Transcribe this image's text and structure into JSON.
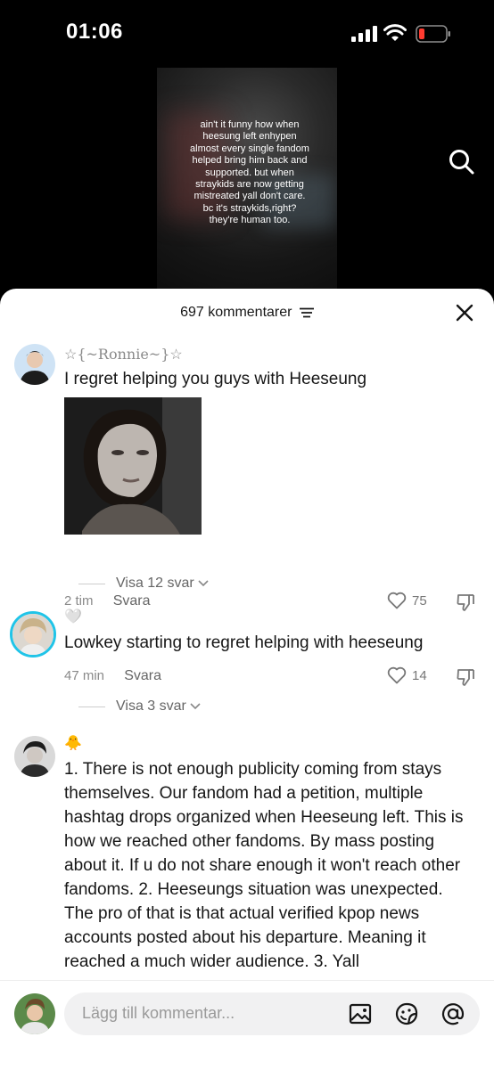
{
  "status_bar": {
    "time": "01:06"
  },
  "video": {
    "caption": "ain't it funny how when heesung left enhypen almost every single fandom helped bring him back and supported. but when straykids are now getting mistreated yall don't care. bc it's straykids,right? they're human too."
  },
  "sheet": {
    "comment_count": "697 kommentarer"
  },
  "comments": [
    {
      "username": "☆{~Ronnie~}☆",
      "text": "I regret helping you guys with Heeseung",
      "time": "2 tim",
      "reply": "Svara",
      "likes": "75",
      "view_replies": "Visa 12 svar"
    },
    {
      "username": "🤍",
      "text": "Lowkey starting to regret helping with heeseung",
      "time": "47 min",
      "reply": "Svara",
      "likes": "14",
      "view_replies": "Visa 3 svar"
    },
    {
      "username": "🐥",
      "text": "1. There is not enough publicity coming from stays themselves. Our fandom had a petition, multiple hashtag drops organized when Heeseung left. This is how we reached other fandoms. By mass posting about it. If u do not share enough it won't reach other fandoms. 2. Heeseungs situation was unexpected. The pro of that is that actual verified kpop news accounts posted about his departure. Meaning it reached a much wider audience. 3. Yall"
    }
  ],
  "input": {
    "placeholder": "Lägg till kommentar..."
  },
  "colors": {
    "accent_ring": "#20c4e8",
    "battery_low": "#ff3b30"
  }
}
